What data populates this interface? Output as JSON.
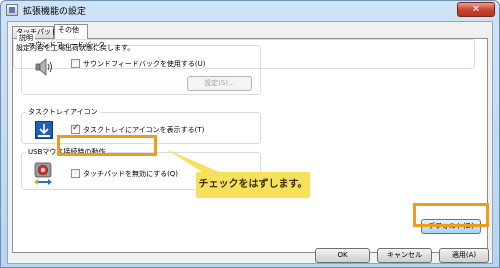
{
  "window": {
    "title": "拡張機能の設定",
    "close_glyph": "✕"
  },
  "tabs": [
    {
      "label": "タッチパッド",
      "active": false
    },
    {
      "label": "その他",
      "active": true
    }
  ],
  "sound_feedback": {
    "group_title": "サウンドフィードバック",
    "icon": "speaker-icon",
    "checkbox_label": "サウンドフィードバックを使用する(U)",
    "checked": false,
    "settings_button": "設定(S)..."
  },
  "task_tray_icon": {
    "group_title": "タスクトレイアイコン",
    "icon": "tray-icon",
    "checkbox_label": "タスクトレイにアイコンを表示する(T)",
    "checked": true
  },
  "usb_mouse": {
    "group_title": "USBマウス接続時の動作",
    "icon": "usb-mouse-icon",
    "checkbox_label": "タッチパッドを無効にする(Q)",
    "checked": false
  },
  "description": {
    "group_title": "説明",
    "text": "設定内容を工場出荷状態に戻します。",
    "default_button": "デフォルト(D)"
  },
  "callout": {
    "text": "チェックをはずします。"
  },
  "footer": {
    "ok": "OK",
    "cancel": "キャンセル",
    "apply": "適用(A)"
  },
  "colors": {
    "highlight": "#f39a1a",
    "callout_bg": "#f6e05c",
    "title_bar": "#cfe3f6",
    "close_button": "#c5432a"
  }
}
